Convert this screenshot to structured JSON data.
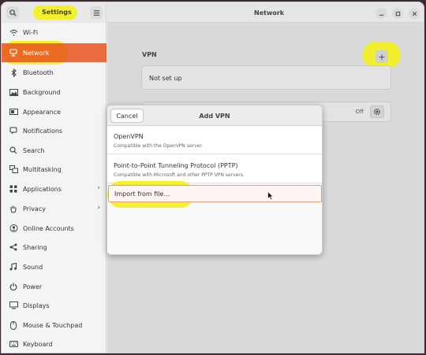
{
  "header": {
    "sidebar_title": "Settings",
    "page_title": "Network"
  },
  "sidebar": {
    "items": [
      {
        "label": "Wi-Fi",
        "icon": "wifi-icon"
      },
      {
        "label": "Network",
        "icon": "network-icon",
        "active": true
      },
      {
        "label": "Bluetooth",
        "icon": "bluetooth-icon"
      },
      {
        "label": "Background",
        "icon": "background-icon"
      },
      {
        "label": "Appearance",
        "icon": "appearance-icon"
      },
      {
        "label": "Notifications",
        "icon": "bell-icon"
      },
      {
        "label": "Search",
        "icon": "search-icon"
      },
      {
        "label": "Multitasking",
        "icon": "multitasking-icon"
      },
      {
        "label": "Applications",
        "icon": "applications-icon",
        "chevron": true
      },
      {
        "label": "Privacy",
        "icon": "hand-icon",
        "chevron": true
      },
      {
        "label": "Online Accounts",
        "icon": "accounts-icon"
      },
      {
        "label": "Sharing",
        "icon": "sharing-icon"
      },
      {
        "label": "Sound",
        "icon": "music-note-icon"
      },
      {
        "label": "Power",
        "icon": "power-icon"
      },
      {
        "label": "Displays",
        "icon": "display-icon"
      },
      {
        "label": "Mouse & Touchpad",
        "icon": "mouse-icon"
      },
      {
        "label": "Keyboard",
        "icon": "keyboard-icon"
      }
    ]
  },
  "main": {
    "vpn_label": "VPN",
    "add_label": "+",
    "not_set_up": "Not set up",
    "switch_state": "Off"
  },
  "dialog": {
    "title": "Add VPN",
    "cancel_label": "Cancel",
    "options": [
      {
        "title": "OpenVPN",
        "subtitle": "Compatible with the OpenVPN server."
      },
      {
        "title": "Point-to-Point Tunneling Protocol (PPTP)",
        "subtitle": "Compatible with Microsoft and other PPTP VPN servers."
      }
    ],
    "import_label": "Import from file…"
  },
  "colors": {
    "accent": "#e95420",
    "highlight": "#f4f023"
  }
}
